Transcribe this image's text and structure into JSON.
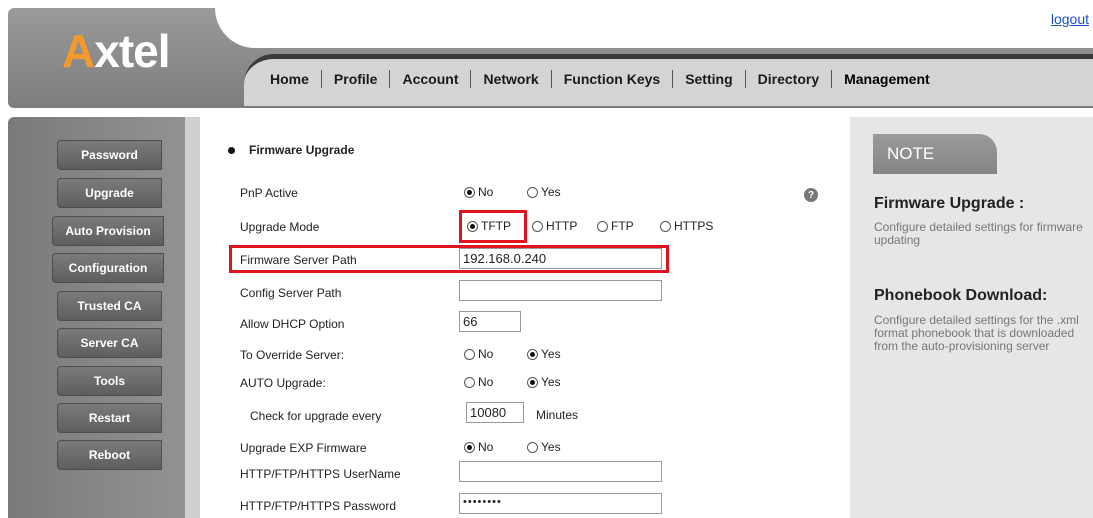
{
  "header": {
    "logo_prefix": "A",
    "logo_suffix": "xtel",
    "logout": "logout",
    "nav": [
      "Home",
      "Profile",
      "Account",
      "Network",
      "Function Keys",
      "Setting",
      "Directory",
      "Management"
    ]
  },
  "sidebar": {
    "items": [
      "Password",
      "Upgrade",
      "Auto Provision",
      "Configuration",
      "Trusted CA",
      "Server CA",
      "Tools",
      "Restart",
      "Reboot"
    ]
  },
  "form": {
    "section_title": "Firmware Upgrade",
    "pnp_active": {
      "label": "PnP Active",
      "options": [
        "No",
        "Yes"
      ],
      "selected": "No"
    },
    "upgrade_mode": {
      "label": "Upgrade Mode",
      "options": [
        "TFTP",
        "HTTP",
        "FTP",
        "HTTPS"
      ],
      "selected": "TFTP"
    },
    "firmware_server_path": {
      "label": "Firmware Server Path",
      "value": "192.168.0.240"
    },
    "config_server_path": {
      "label": "Config Server Path",
      "value": ""
    },
    "allow_dhcp_option": {
      "label": "Allow DHCP Option",
      "value": "66"
    },
    "override_server": {
      "label": "To Override Server:",
      "options": [
        "No",
        "Yes"
      ],
      "selected": "Yes"
    },
    "auto_upgrade": {
      "label": "AUTO Upgrade:",
      "options": [
        "No",
        "Yes"
      ],
      "selected": "Yes"
    },
    "check_every": {
      "label": "Check for upgrade every",
      "value": "10080",
      "unit": "Minutes"
    },
    "upgrade_exp": {
      "label": "Upgrade EXP Firmware",
      "options": [
        "No",
        "Yes"
      ],
      "selected": "No"
    },
    "username": {
      "label": "HTTP/FTP/HTTPS UserName",
      "value": ""
    },
    "password": {
      "label": "HTTP/FTP/HTTPS Password",
      "value": "••••••••"
    },
    "help_icon": "?"
  },
  "note": {
    "tab": "NOTE",
    "h1": "Firmware Upgrade :",
    "p1": "Configure detailed settings for firmware updating",
    "h2": "Phonebook Download:",
    "p2": "Configure detailed settings for the .xml format phonebook that is downloaded from the auto-provisioning server"
  },
  "colors": {
    "accent_orange": "#f39a2a",
    "highlight_red": "#e0141e",
    "link_blue": "#1a4fc4"
  }
}
